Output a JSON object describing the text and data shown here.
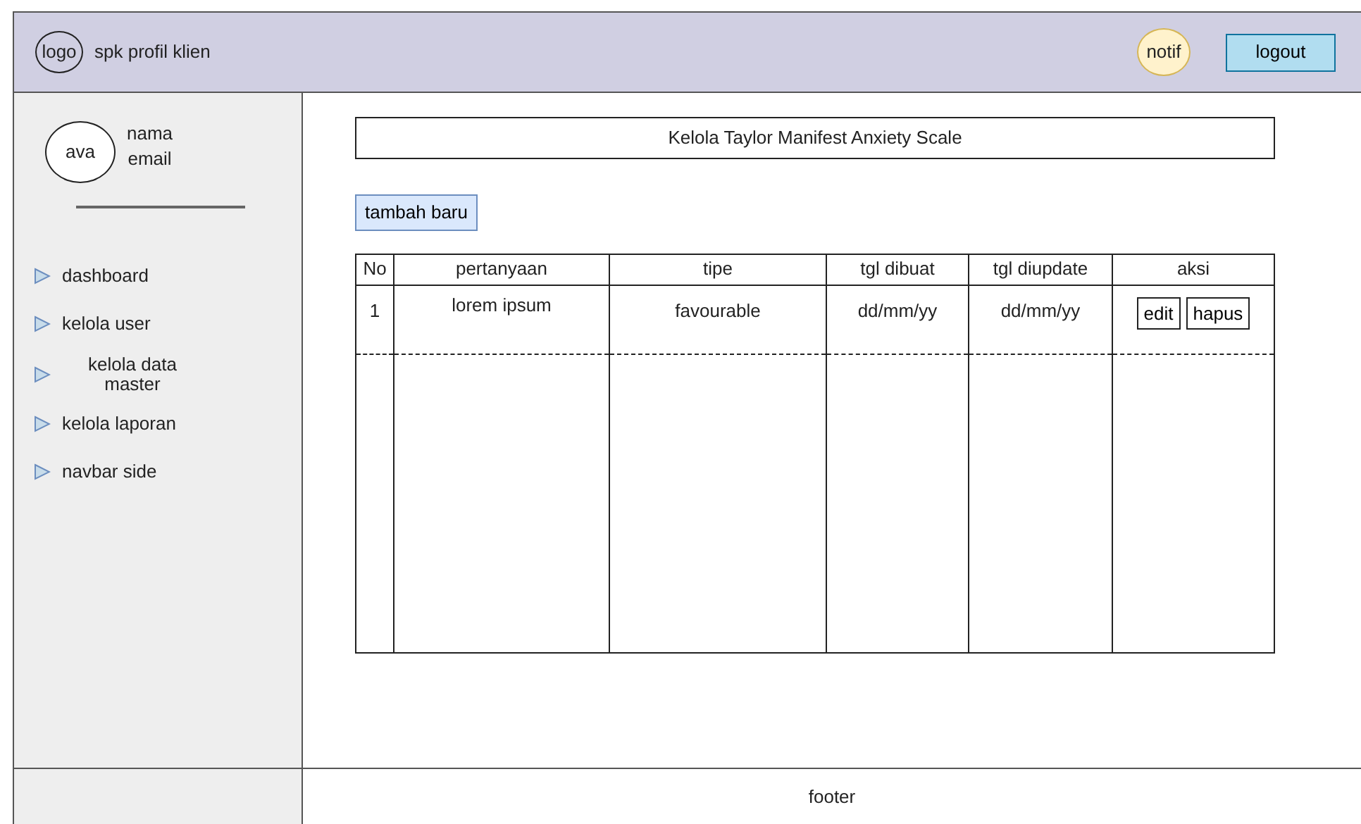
{
  "header": {
    "logo": "logo",
    "title": "spk profil klien",
    "notif": "notif",
    "logout": "logout"
  },
  "sidebar": {
    "avatar": "ava",
    "name": "nama",
    "email": "email",
    "items": [
      {
        "label": "dashboard"
      },
      {
        "label": "kelola user"
      },
      {
        "label": "kelola data master"
      },
      {
        "label": "kelola laporan"
      },
      {
        "label": "navbar side"
      }
    ]
  },
  "page_title": "Kelola Taylor Manifest Anxiety Scale",
  "add_button": "tambah baru",
  "table": {
    "columns": [
      "No",
      "pertanyaan",
      "tipe",
      "tgl dibuat",
      "tgl diupdate",
      "aksi"
    ],
    "rows": [
      {
        "cells": [
          "1",
          "lorem ipsum",
          "favourable",
          "dd/mm/yy",
          "dd/mm/yy"
        ],
        "actions": [
          "edit",
          "hapus"
        ]
      }
    ]
  },
  "footer": "footer"
}
